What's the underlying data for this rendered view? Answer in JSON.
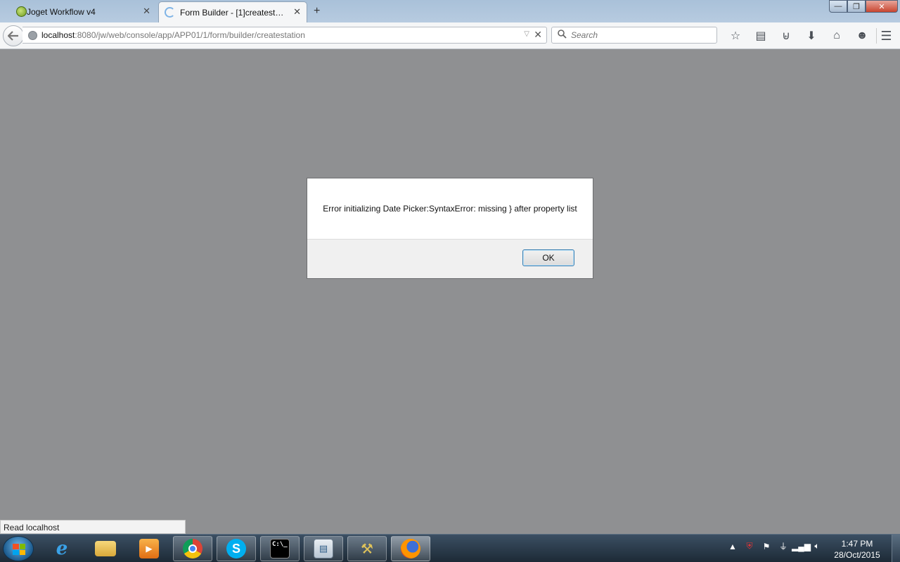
{
  "browser": {
    "tabs": [
      {
        "label": "Joget Workflow v4",
        "close": "✕",
        "icon": "joget-icon"
      },
      {
        "label": "Form Builder - [1]createsta...",
        "close": "✕",
        "icon": "loading-icon"
      }
    ],
    "new_tab": "+",
    "window_controls": {
      "minimize": "—",
      "maximize": "❐",
      "close": "✕"
    },
    "url": {
      "host": "localhost",
      "path": ":8080/jw/web/console/app/APP01/1/form/builder/createstation"
    },
    "search_placeholder": "Search",
    "toolbar_icons": [
      "bookmark-star-icon",
      "reading-list-icon",
      "pocket-icon",
      "download-icon",
      "home-icon",
      "chat-icon"
    ],
    "status": "Read localhost"
  },
  "dialog": {
    "message": "Error initializing Date Picker:SyntaxError: missing } after property list",
    "ok_label": "OK"
  },
  "taskbar": {
    "apps": [
      "internet-explorer-icon",
      "file-explorer-icon",
      "media-player-icon",
      "chrome-icon",
      "skype-icon",
      "command-prompt-icon",
      "news-app-icon",
      "tools-icon",
      "firefox-icon"
    ],
    "clock_time": "1:47 PM",
    "clock_date": "28/Oct/2015"
  },
  "colors": {
    "overlay": "#8f9092",
    "dialog_border": "#6d6e70",
    "ok_border": "#3c7fb1"
  }
}
